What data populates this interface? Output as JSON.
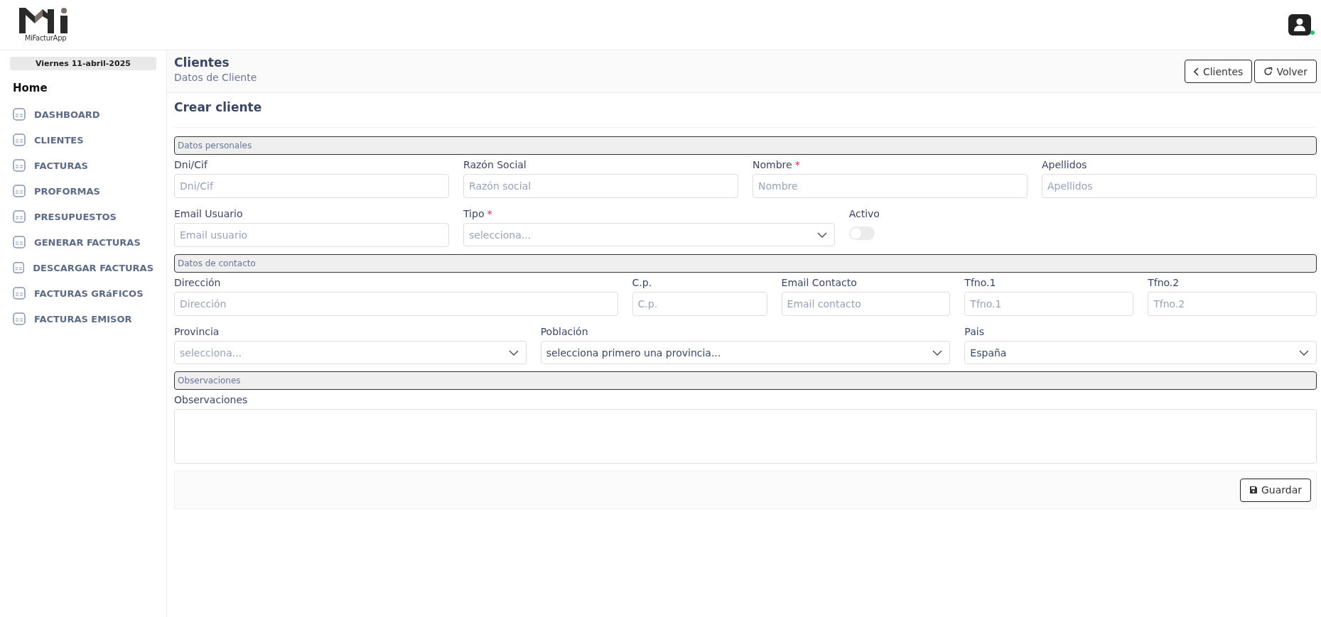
{
  "header": {
    "logo_text": "MiFacturApp",
    "user_online": true
  },
  "sidebar": {
    "date": "Viernes 11-abril-2025",
    "heading": "Home",
    "items": [
      {
        "label": "DASHBOARD"
      },
      {
        "label": "CLIENTES"
      },
      {
        "label": "FACTURAS"
      },
      {
        "label": "PROFORMAS"
      },
      {
        "label": "PRESUPUESTOS"
      },
      {
        "label": "GENERAR FACTURAS"
      },
      {
        "label": "DESCARGAR FACTURAS"
      },
      {
        "label": "FACTURAS GRáFICOS"
      },
      {
        "label": "FACTURAS EMISOR"
      }
    ]
  },
  "page": {
    "title": "Clientes",
    "subtitle": "Datos de Cliente",
    "buttons": [
      {
        "kind": "back",
        "label": "Clientes"
      },
      {
        "kind": "reload",
        "label": "Volver"
      }
    ]
  },
  "form": {
    "title": "Crear cliente",
    "sections": [
      {
        "title": "Datos personales",
        "fields": [
          {
            "kind": "text",
            "label": "Dni/Cif",
            "placeholder": "Dni/Cif"
          },
          {
            "kind": "text",
            "label": "Razón Social",
            "placeholder": "Razón social"
          },
          {
            "kind": "text",
            "label": "Nombre",
            "placeholder": "Nombre",
            "required_mark": "*"
          },
          {
            "kind": "text",
            "label": "Apellidos",
            "placeholder": "Apellidos"
          },
          {
            "kind": "text",
            "label": "Email Usuario",
            "placeholder": "Email usuario"
          },
          {
            "kind": "select",
            "label": "Tipo",
            "placeholder": "selecciona...",
            "required_mark": "*"
          },
          {
            "kind": "toggle",
            "label": "Activo",
            "on": false
          }
        ]
      },
      {
        "title": "Datos de contacto",
        "fields": [
          {
            "kind": "text",
            "label": "Dirección",
            "placeholder": "Dirección"
          },
          {
            "kind": "text",
            "label": "C.p.",
            "placeholder": "C.p."
          },
          {
            "kind": "text",
            "label": "Email Contacto",
            "placeholder": "Email contacto"
          },
          {
            "kind": "text",
            "label": "Tfno.1",
            "placeholder": "Tfno.1"
          },
          {
            "kind": "text",
            "label": "Tfno.2",
            "placeholder": "Tfno.2"
          },
          {
            "kind": "select",
            "label": "Provincia",
            "placeholder": "selecciona..."
          },
          {
            "kind": "select",
            "label": "Población",
            "value": "selecciona primero una provincia..."
          },
          {
            "kind": "select",
            "label": "Pais",
            "value": "España"
          }
        ]
      },
      {
        "title": "Observaciones",
        "fields": [
          {
            "kind": "textarea",
            "label": "Observaciones"
          }
        ]
      }
    ],
    "save_button": "Guardar"
  }
}
